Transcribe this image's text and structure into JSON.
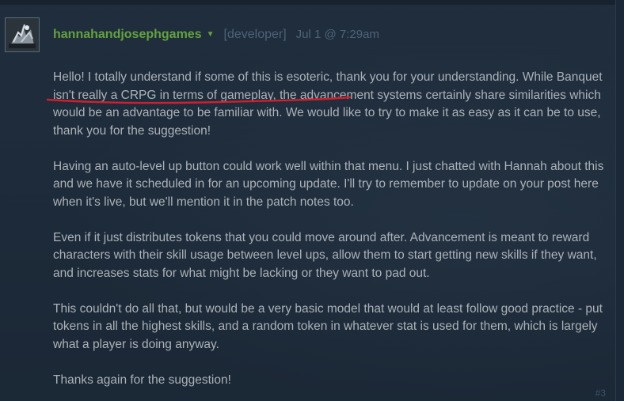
{
  "post": {
    "author": "hannahandjosephgames",
    "role": "[developer]",
    "timestamp": "Jul 1 @ 7:29am",
    "post_number": "#3",
    "paragraphs": [
      "Hello! I totally understand if some of this is esoteric, thank you for your understanding. While Banquet isn't really a CRPG in terms of gameplay, the advancement systems certainly share similarities which would be an advantage to be familiar with. We would like to try to make it as easy as it can be to use, thank you for the suggestion!",
      "Having an auto-level up button could work well within that menu. I just chatted with Hannah about this and we have it scheduled in for an upcoming update. I'll try to remember to update on your post here when it's live, but we'll mention it in the patch notes too.",
      "Even if it just distributes tokens that you could move around after. Advancement is meant to reward characters with their skill usage between level ups, allow them to start getting new skills if they want, and increases stats for what might be lacking or they want to pad out.",
      "This couldn't do all that, but would be a very basic model that would at least follow good practice - put tokens in all the highest skills, and a random token in whatever stat is used for them, which is largely what a player is doing anyway.",
      "Thanks again for the suggestion!"
    ]
  },
  "icons": {
    "author_menu": "caret-down-icon",
    "avatar": "avatar-image"
  },
  "colors": {
    "background": "#1e2b3a",
    "author": "#64a140",
    "meta": "#4f6378",
    "text": "#acb2b8",
    "annotation": "#d0202a"
  }
}
